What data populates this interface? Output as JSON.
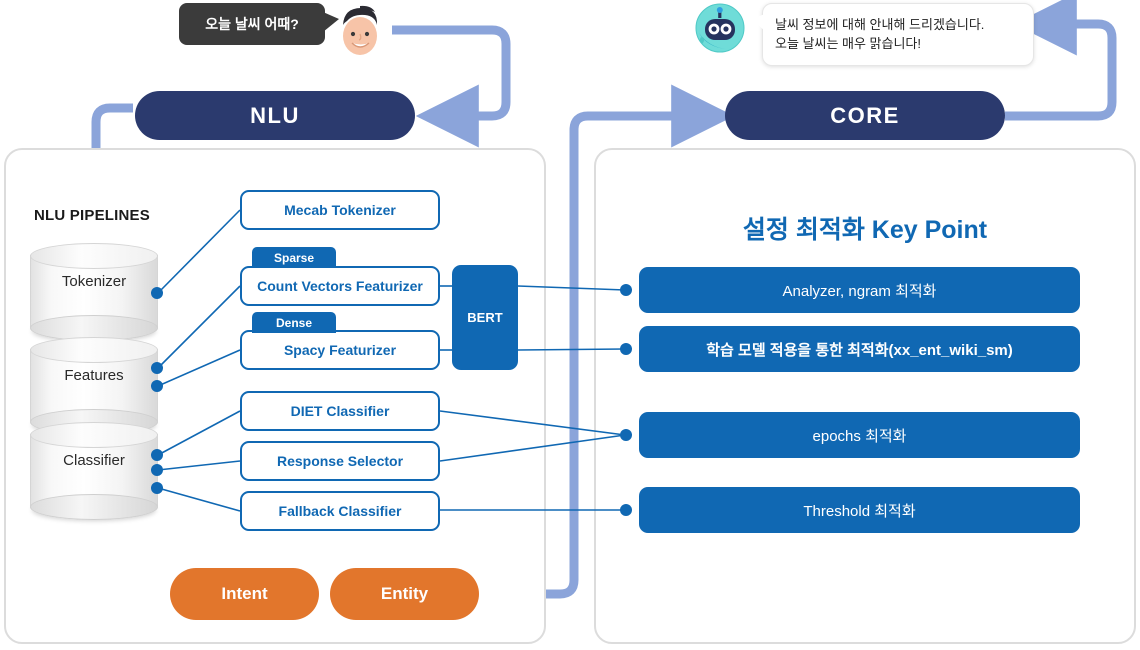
{
  "conversation": {
    "user_avatar_icon": "user-face-icon",
    "user_message": "오늘 날씨 어때?",
    "bot_avatar_icon": "robot-face-icon",
    "bot_message_line1": "날씨 정보에 대해 안내해 드리겠습니다.",
    "bot_message_line2": "오늘 날씨는 매우 맑습니다!"
  },
  "headers": {
    "nlu": "NLU",
    "core": "CORE"
  },
  "left_panel": {
    "title": "NLU PIPELINES",
    "stages": [
      {
        "label": "Tokenizer"
      },
      {
        "label": "Features"
      },
      {
        "label": "Classifier"
      }
    ],
    "components": [
      {
        "label": "Mecab Tokenizer"
      },
      {
        "label": "Count Vectors Featurizer",
        "tag": "Sparse"
      },
      {
        "label": "Spacy Featurizer",
        "tag": "Dense"
      },
      {
        "label": "DIET Classifier"
      },
      {
        "label": "Response Selector"
      },
      {
        "label": "Fallback Classifier"
      }
    ],
    "tags": {
      "sparse": "Sparse",
      "dense": "Dense"
    },
    "embedding_box": "BERT",
    "outputs": [
      {
        "label": "Intent"
      },
      {
        "label": "Entity"
      }
    ]
  },
  "right_panel": {
    "title": "설정 최적화 Key Point",
    "items": [
      {
        "label": "Analyzer, ngram 최적화"
      },
      {
        "label": "학습 모델 적용을 통한 최적화(xx_ent_wiki_sm)"
      },
      {
        "label": "epochs 최적화"
      },
      {
        "label": "Threshold 최적화"
      }
    ]
  },
  "colors": {
    "header_navy": "#2b3a6e",
    "accent_blue": "#1068b3",
    "arrow_blue": "#8ba4da",
    "orange": "#e2762c",
    "panel_border": "#dcdcdc",
    "bubble_dark": "#3b3b3b"
  }
}
